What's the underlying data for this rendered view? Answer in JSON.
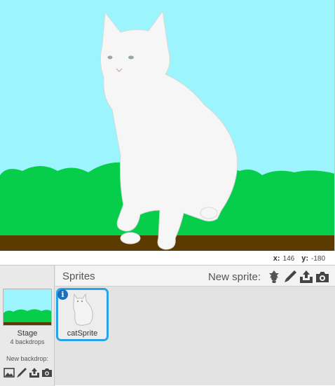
{
  "coords": {
    "x_label": "x:",
    "x_value": "146",
    "y_label": "y:",
    "y_value": "-180"
  },
  "sprites_panel": {
    "title": "Sprites",
    "new_sprite_label": "New sprite:",
    "new_sprite_tools": [
      "choose-from-library-icon",
      "paint-brush-icon",
      "upload-icon",
      "camera-icon"
    ]
  },
  "stage_panel": {
    "name": "Stage",
    "backdrop_count": "4 backdrops",
    "new_backdrop_label": "New backdrop:",
    "new_backdrop_tools": [
      "image-library-icon",
      "paint-brush-icon",
      "upload-icon",
      "camera-icon"
    ]
  },
  "sprites": [
    {
      "name": "catSprite",
      "selected": true
    }
  ],
  "colors": {
    "sky": "#9cf5fc",
    "grass": "#06cd4a",
    "ground": "#5b3b00",
    "selection": "#29a4e8"
  }
}
